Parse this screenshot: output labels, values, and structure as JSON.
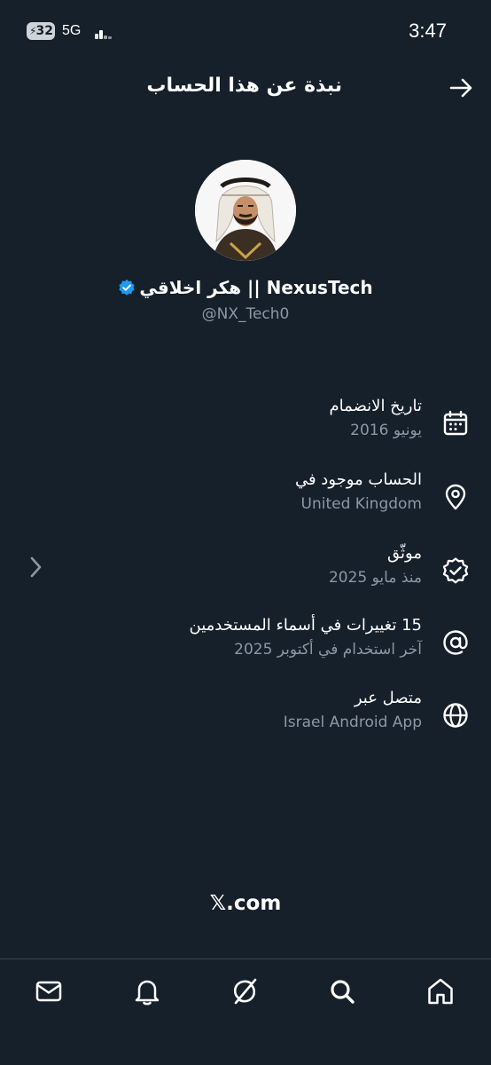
{
  "status_bar": {
    "battery": "32",
    "network": "5G",
    "time": "3:47"
  },
  "header": {
    "title": "نبذة عن هذا الحساب",
    "back_icon": "arrow-right-icon"
  },
  "profile": {
    "display_name": "هكر اخلاقي || NexusTech",
    "handle": "@NX_Tech0",
    "verified": true,
    "verified_color": "#1d9bf0"
  },
  "info": [
    {
      "icon": "calendar-icon",
      "title": "تاريخ الانضمام",
      "subtitle": "يونيو 2016"
    },
    {
      "icon": "location-pin-icon",
      "title": "الحساب موجود في",
      "subtitle": "United Kingdom"
    },
    {
      "icon": "verified-badge-icon",
      "title": "موثّق",
      "subtitle": "منذ مايو 2025"
    },
    {
      "icon": "at-sign-icon",
      "title": "15 تغييرات في أسماء المستخدمين",
      "subtitle": "آخر استخدام في أكتوبر 2025"
    },
    {
      "icon": "globe-icon",
      "title": "متصل عبر",
      "subtitle": "Israel Android App"
    }
  ],
  "footer": {
    "brand": "𝕏.com"
  },
  "bottom_nav": [
    "mail-icon",
    "bell-icon",
    "grok-icon",
    "search-icon",
    "home-icon"
  ],
  "colors": {
    "background": "#15202b",
    "text_primary": "#ffffff",
    "text_secondary": "#8b98a5",
    "divider": "#38444d"
  }
}
